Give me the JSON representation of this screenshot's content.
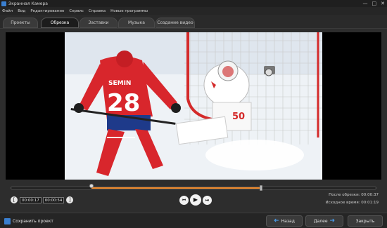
{
  "window": {
    "title": "Экранная Камера",
    "minimize": "—",
    "maximize": "□",
    "close": "✕"
  },
  "menu": [
    "Файл",
    "Вид",
    "Редактирование",
    "Сервис",
    "Справка",
    "Новые программы"
  ],
  "tabs": [
    {
      "label": "Проекты",
      "active": false
    },
    {
      "label": "Обрезка",
      "active": true
    },
    {
      "label": "Заставки",
      "active": false
    },
    {
      "label": "Музыка",
      "active": false
    },
    {
      "label": "Создание видео",
      "active": false
    }
  ],
  "preview": {
    "player_name": "SEMIN",
    "player_number": "28",
    "goalie_number": "50"
  },
  "timeline": {
    "start_fraction": 0.22,
    "end_fraction": 0.685
  },
  "trim": {
    "start_time": "00:00:17",
    "end_time": "00:00:54",
    "prev_icon": "[",
    "next_icon": "]"
  },
  "playback": {
    "rewind_icon": "⏮",
    "play_icon": "▶",
    "forward_icon": "⏭"
  },
  "info": {
    "after_label": "После обрезки:",
    "after_value": "00:00:37",
    "source_label": "Исходное время:",
    "source_value": "00:01:19"
  },
  "buttons": {
    "save": "Сохранить проект",
    "back": "Назад",
    "next": "Далее",
    "close": "Закрыть"
  },
  "colors": {
    "accent": "#f08a2a",
    "arrow": "#4a9be8",
    "brand_icon": "#3a7fd0"
  }
}
